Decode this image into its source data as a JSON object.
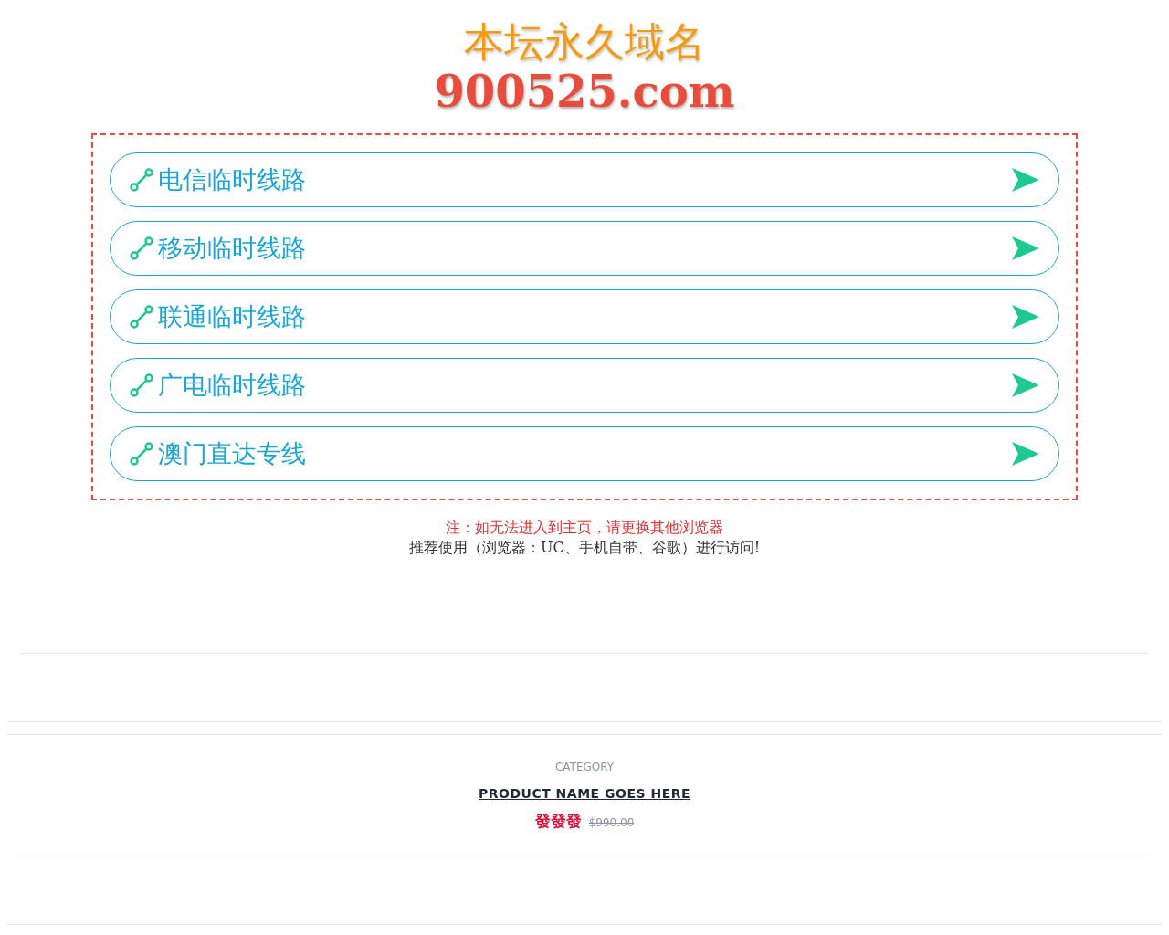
{
  "header": {
    "title": "本坛永久域名",
    "domain": "900525.com"
  },
  "links": [
    {
      "label": "电信临时线路"
    },
    {
      "label": "移动临时线路"
    },
    {
      "label": "联通临时线路"
    },
    {
      "label": "广电临时线路"
    },
    {
      "label": "澳门直达专线"
    }
  ],
  "notice": {
    "warning": "注：如无法进入到主页，请更换其他浏览器",
    "recommend": "推荐使用（浏览器：UC、手机自带、谷歌）进行访问!"
  },
  "product": {
    "category": "CATEGORY",
    "name": "PRODUCT NAME GOES HERE",
    "price": "發發發",
    "old_price": "$990.00"
  }
}
